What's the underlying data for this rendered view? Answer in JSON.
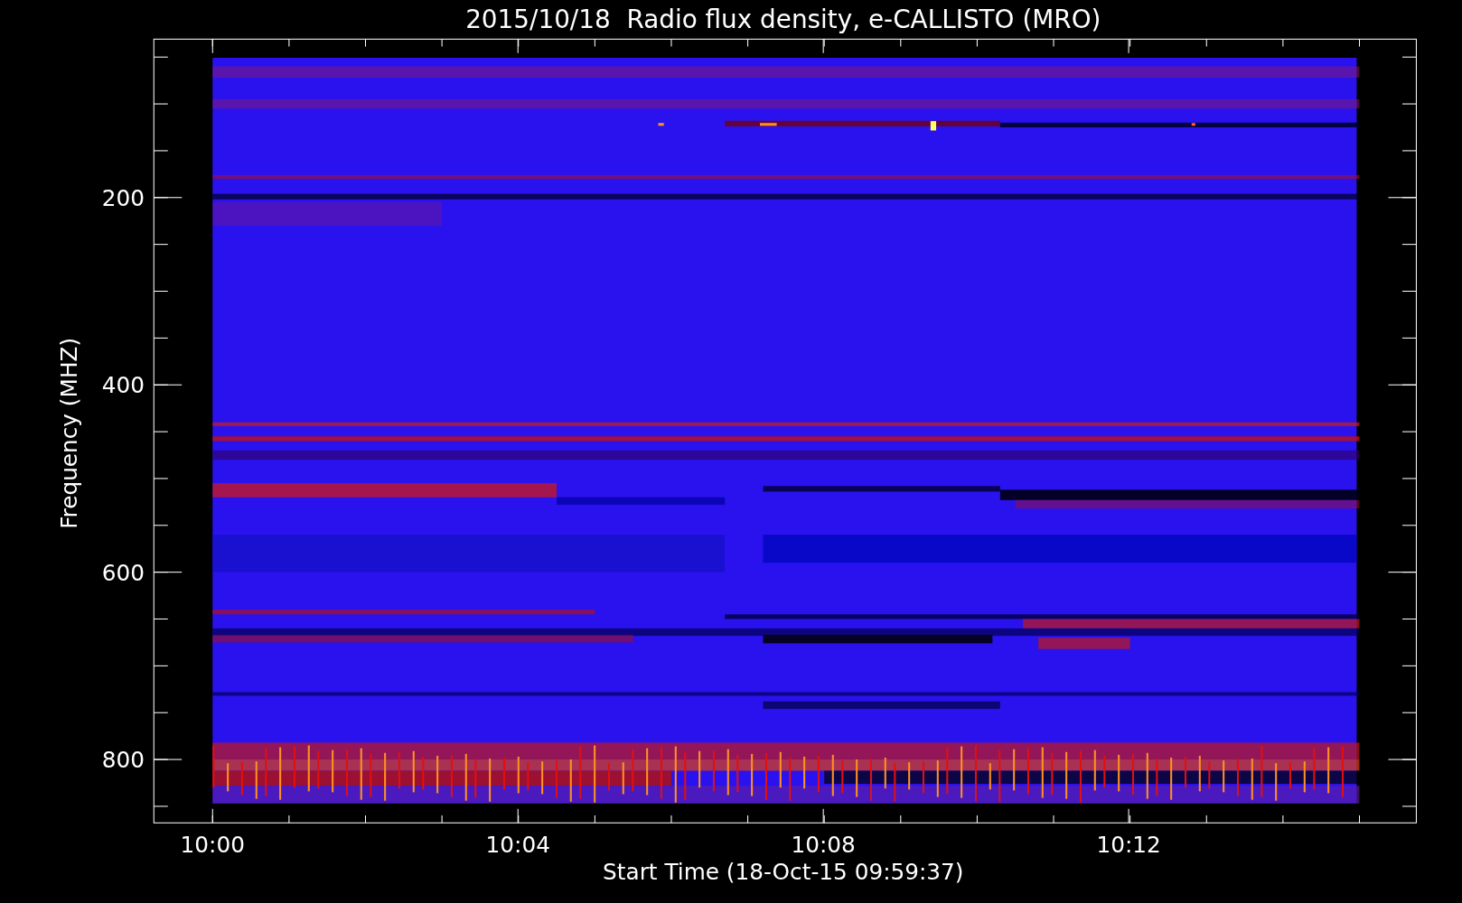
{
  "title": "2015/10/18  Radio flux density, e-CALLISTO (MRO)",
  "y_axis": {
    "label": "Frequency (MHZ)",
    "ticks": [
      "200",
      "400",
      "600",
      "800"
    ]
  },
  "x_axis": {
    "label": "Start Time (18-Oct-15 09:59:37)",
    "ticks": [
      "10:00",
      "10:04",
      "10:08",
      "10:12"
    ]
  }
}
